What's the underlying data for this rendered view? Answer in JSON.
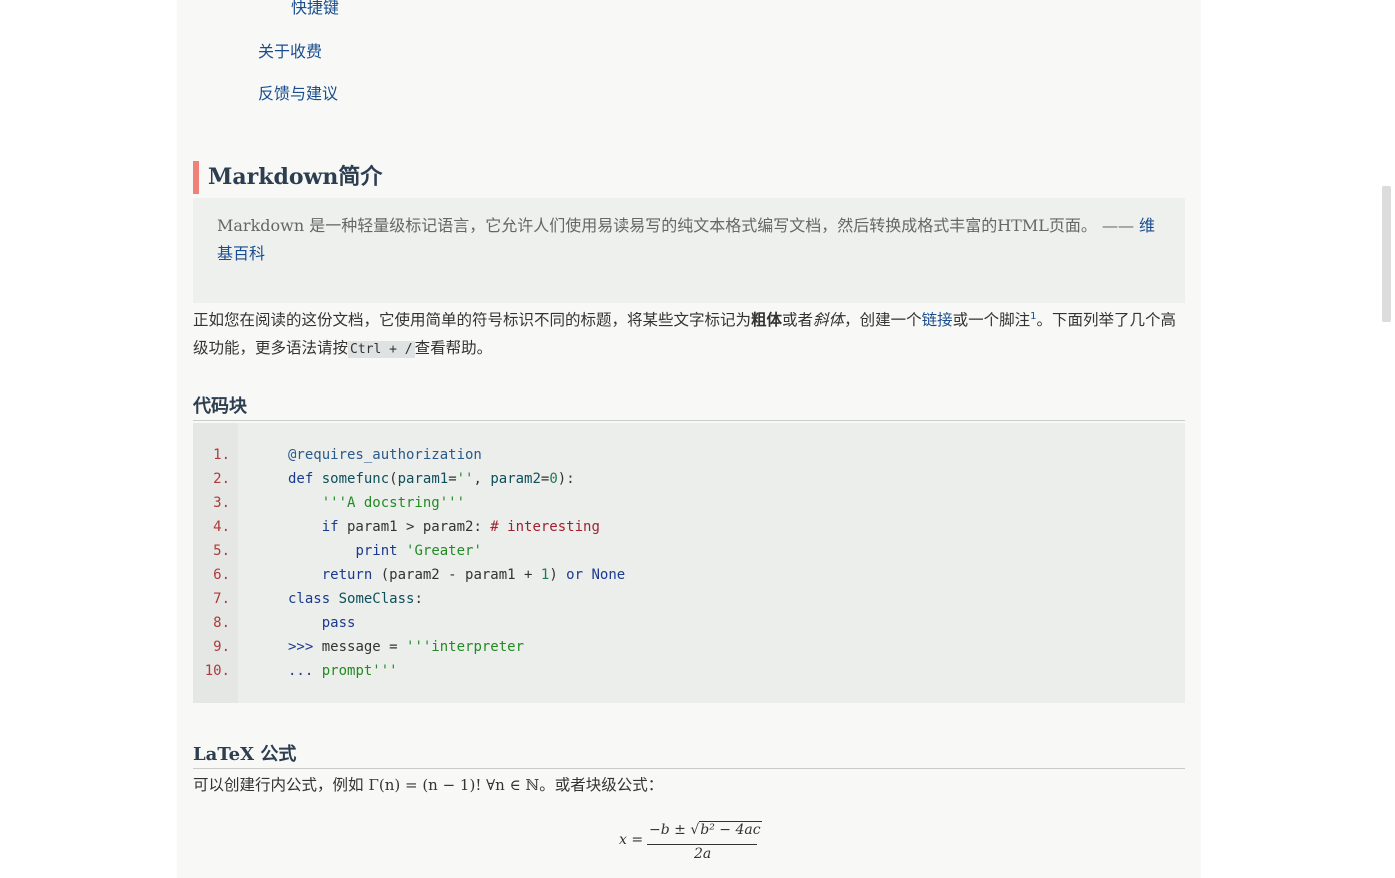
{
  "toc": {
    "shortcuts": "快捷键",
    "pricing": "关于收费",
    "feedback": "反馈与建议"
  },
  "intro": {
    "heading": "Markdown简介",
    "quote_text": "Markdown 是一种轻量级标记语言，它允许人们使用易读易写的纯文本格式编写文档，然后转换成格式丰富的HTML页面。 —— ",
    "quote_link": "维基百科",
    "para_1": "正如您在阅读的这份文档，它使用简单的符号标识不同的标题，将某些文字标记为",
    "bold": "粗体",
    "para_2": "或者",
    "italic": "斜体",
    "para_3": "，创建一个",
    "link": "链接",
    "para_4": "或一个脚注",
    "footnote": "1",
    "para_5": "。下面列举了几个高级功能，更多语法请按",
    "shortcut_code": "Ctrl + /",
    "para_6": "查看帮助。"
  },
  "code_section": {
    "heading": "代码块",
    "line_numbers": [
      "1.",
      "2.",
      "3.",
      "4.",
      "5.",
      "6.",
      "7.",
      "8.",
      "9.",
      "10."
    ]
  },
  "latex_section": {
    "heading": "LaTeX 公式",
    "inline_prefix": "可以创建行内公式，例如 ",
    "inline_math": "Γ(n) = (n − 1)!   ∀n ∈ ℕ",
    "inline_suffix": "。或者块级公式：",
    "block_lhs": "x =",
    "block_numerator_a": "−b ± √",
    "block_numerator_b": "b² − 4ac",
    "block_denominator": "2a"
  }
}
